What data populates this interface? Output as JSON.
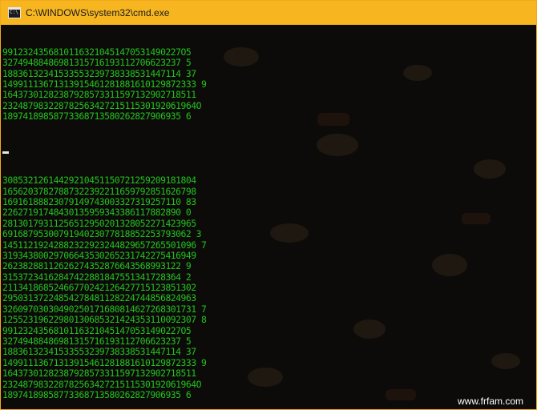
{
  "window": {
    "title": "C:\\WINDOWS\\system32\\cmd.exe",
    "icon": "cmd-icon",
    "icon_text": "C:\\",
    "accent_color": "#f7b620"
  },
  "console": {
    "text_color": "#22c21f",
    "background_color": "#0d0b09",
    "block1": [
      "99123243568101163210451470531490227O5",
      "32749488486981315716193112706623237 5",
      "18836132341533553239738338531447114 37",
      "14991113671313915461281881610129872333 9",
      "16437301282387928573311597132902718511",
      "23248798322878256342721511530192061964O",
      "18974189858773368713580262827906935 6"
    ],
    "block2": [
      "30853212614429210451150721259209181804",
      "16562037827887322392211659792851626798",
      "16916188823079149743003327319257110 83",
      "22627191748430135959343386117882890 0",
      "28130179311256512950201328052271423965",
      "6916879530079194023077818852253793062 3",
      "14511219242882322923244829657265501096 7",
      "31934380029706643530265231742275416949",
      "26238288112626274352876643568993122 9",
      "31537234162847422881847551341728364 2",
      "21134186852466770242126427715123851302",
      "29503137224854278481128224744856824963",
      "32609703030490250171680814627268301731 7",
      "12552319622980130685321424353110092307 8",
      "99123243568101163210451470531490227O5",
      "32749488486981315716193112706623237 5",
      "18836132341533553239738338531447114 37",
      "14991113671313915461281881610129872333 9",
      "16437301282387928573311597132902718511",
      "23248798322878256342721511530192061964O",
      "18974189858773368713580262827906935 6"
    ]
  },
  "watermark": "www.frfam.com"
}
